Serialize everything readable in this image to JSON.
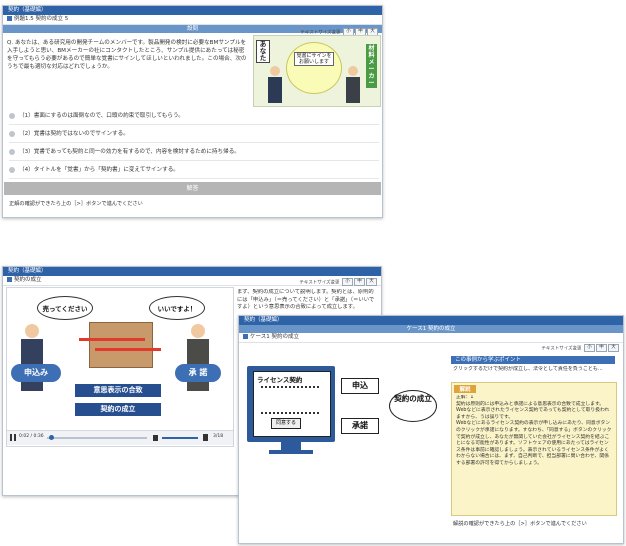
{
  "win1": {
    "title": "契約（基礎編）",
    "breadcrumb": "例題1.5 契約の成立 5",
    "text_size": "テキストサイズ変更",
    "size_btns": [
      "小",
      "中",
      "大"
    ],
    "question_header": "設問",
    "question": "Q. あなたは、ある研究用の開発チームのメンバーです。製品開発の検討に必要なBMサンプルを入手しようと思い、BMメーカーの社にコンタクトしたところ、サンプル提供にあたっては秘密を守ってもらう必要があるので簡単な覚書にサインしてほしいといわれました。この場合、次のうちで最も適切な対応はどれでしょうか。",
    "illus": {
      "you": "あなた",
      "bubble": "覚書にサインをお願いします",
      "maker": "材料メーカー"
    },
    "options": [
      "（1）書面にするのは面倒なので、口頭の約束で取引してもらう。",
      "（2）覚書は契約ではないのでサインする。",
      "（3）覚書であっても契約と同一の効力を有するので、内容を検討するために持ち帰る。",
      "（4）タイトルを「覚書」から「契約書」に変えてサインする。"
    ],
    "answer_label": "解答",
    "footer": "正解の確認ができたら上の［>］ボタンで進んでください"
  },
  "win2": {
    "title": "契約（基礎編）",
    "breadcrumb": "契約の成立",
    "text_size": "テキストサイズ変更",
    "size_btns": [
      "小",
      "中",
      "大"
    ],
    "bubble_left": "売ってください",
    "bubble_right": "いいですよ！",
    "offer": "申込み",
    "accept": "承 諾",
    "caption1": "意思表示の合致",
    "caption2": "契約の成立",
    "player_time": "0:02 / 0:36",
    "page_count": "3/18",
    "side_text": "まず、契約の成立について説明します。契約とは、原則的には「申込み」（＝売ってください）と「承諾」（＝いいですよ）という意思表示の合致によって成立します。"
  },
  "win3": {
    "title": "契約（基礎編）",
    "case_title": "ケース1 契約の成立",
    "breadcrumb": "ケース1 契約の成立",
    "text_size": "テキストサイズ変更",
    "size_btns": [
      "小",
      "中",
      "大"
    ],
    "license_title": "ライセンス契約",
    "agree_btn": "同意する",
    "offer": "申込",
    "accept": "承諾",
    "contract": "契約の成立",
    "point_header": "この事例から学ぶポイント",
    "point_text": "クリックするだけで契約が成立し、法令として責任を負うことも...",
    "answer_header": "解説",
    "answer_text": "正解：1\n契約は原則的には申込みと承諾による意思表示の合致で成立します。\nWebなどに表示されたライセンス契約であっても契約として取り扱われますから、うは誤りです。\nWebなどにあるライセンス契約の表示が申し込みにあたり、同意ボタンのクリックが承諾になります。すなわち、「同意する」ボタンのクリックで契約が成立し、あなたが無関していた会社がライセンス契約を結ぶことになる可能性があります。ソフトウェアの使用にあたってはライセンス条件は事前に確認しましょう。表示されているライセンス条件がよくわからない場合には、まず、自己判断で、担当部署に問い合わせ、関係する部署の許可を得てからしましょう。",
    "footer": "解説の確認ができたら上の［>］ボタンで進んでください"
  }
}
